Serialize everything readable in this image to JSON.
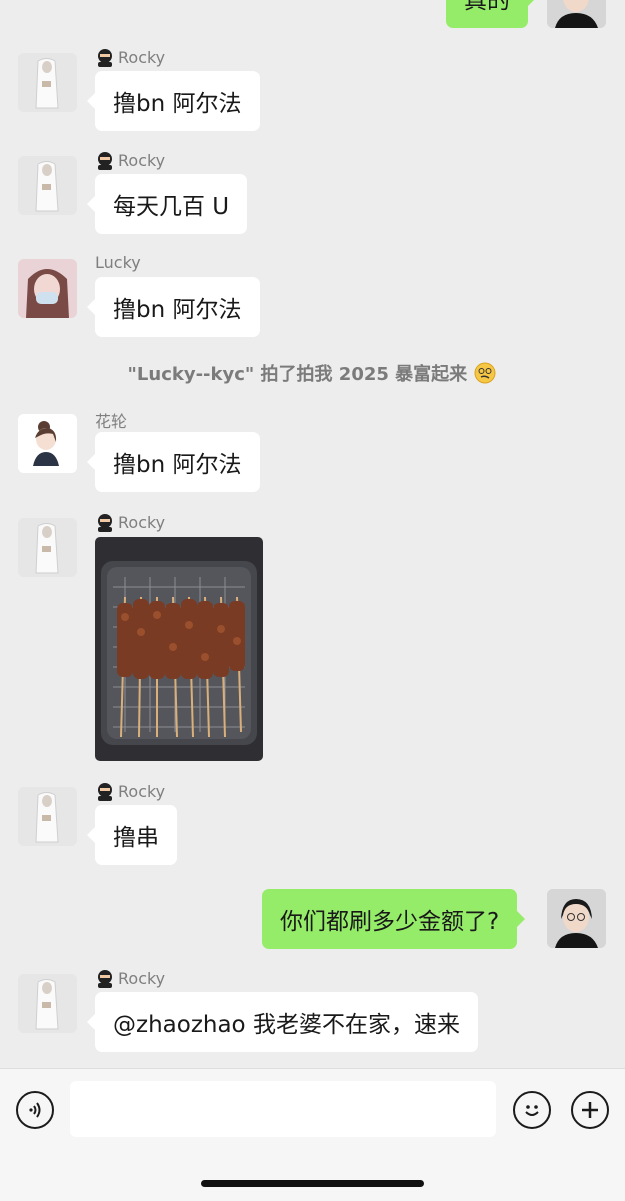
{
  "top_message": {
    "text": "真的"
  },
  "messages": [
    {
      "sender": "Rocky",
      "text": "撸bn 阿尔法"
    },
    {
      "sender": "Rocky",
      "text": "每天几百 U"
    },
    {
      "sender": "Lucky",
      "text": "撸bn 阿尔法"
    },
    {
      "system": "\"Lucky--kyc\" 拍了拍我 2025 暴富起来"
    },
    {
      "sender": "花轮",
      "text": "撸bn 阿尔法"
    },
    {
      "sender": "Rocky",
      "image": "grilled-skewers-photo"
    },
    {
      "sender": "Rocky",
      "text": "撸串"
    },
    {
      "self": true,
      "text": "你们都刷多少金额了?"
    },
    {
      "sender": "Rocky",
      "text": "@zhaozhao 我老婆不在家，速来"
    }
  ],
  "input": {
    "value": "",
    "placeholder": ""
  },
  "icons": [
    "voice-icon",
    "emoji-icon",
    "plus-icon",
    "ninja-icon",
    "dizzy-face-emoji"
  ],
  "colors": {
    "background": "#ededed",
    "bubble_self": "#95ec69",
    "bubble_other": "#ffffff"
  }
}
